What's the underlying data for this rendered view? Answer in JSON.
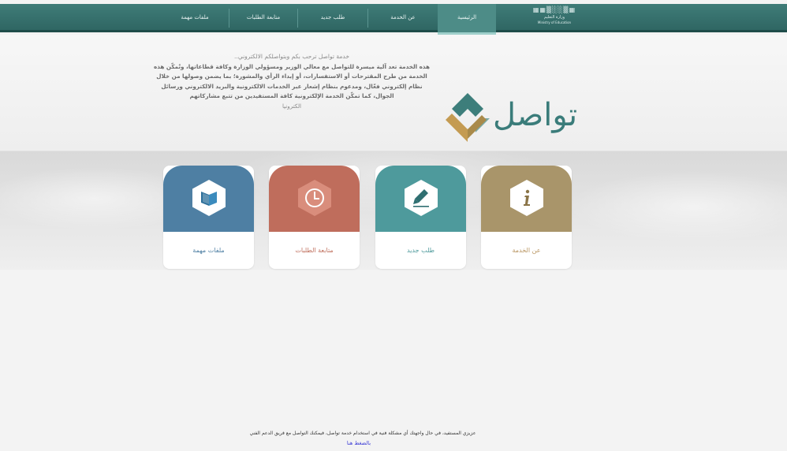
{
  "nav": {
    "logo_dots": "▦▦▒░░▒▦",
    "logo_line1": "وزارة التعليم",
    "logo_line2": "Ministry of Education",
    "items": [
      {
        "label": "الرئيسية",
        "active": true
      },
      {
        "label": "عن الخدمة",
        "active": false
      },
      {
        "label": "طلب جديد",
        "active": false
      },
      {
        "label": "متابعة الطلبات",
        "active": false
      },
      {
        "label": "ملفات مهمة",
        "active": false
      }
    ]
  },
  "hero": {
    "welcome": "خدمة تواصل ترحب بكم وبتواصلكم الالكتروني..",
    "body": "هذه الخدمة تعد آلية ميسرة للتواصل مع معالي الوزير ومسؤولي الوزارة وكافة قطاعاتها، وتُمكّن هذه الخدمة من طرح المقترحات أو الاستفسارات، أو إبداء الرأي والمشورة؛ بما يضمن وصولها من خلال نظام إلكتروني فعّال، ومدعوم بنظام إشعار عبر الخدمات الالكترونية والبريد الالكتروني ورسائل الجوال، كما تمكّن الخدمة الإلكترونية كافة المستفيدين من تتبع مشاركاتهم",
    "tail": "الكترونيا",
    "brand_name": "تواصل"
  },
  "colors": {
    "nav_bg": "#326b68",
    "card_about": "#a9956a",
    "card_new": "#4e9a9c",
    "card_track": "#bf6d5c",
    "card_files": "#4e7fa3",
    "label_about": "#b89460",
    "label_new": "#4e9a9c",
    "label_track": "#c0705e",
    "label_files": "#4e7fa3"
  },
  "cards": [
    {
      "label": "عن الخدمة",
      "icon": "info-icon"
    },
    {
      "label": "طلب جديد",
      "icon": "pencil-icon"
    },
    {
      "label": "متابعة الطلبات",
      "icon": "clock-icon"
    },
    {
      "label": "ملفات مهمة",
      "icon": "book-icon"
    }
  ],
  "footer": {
    "text": "عزيزي المستفيد، في حال واجهتك أي مشكلة فنية في استخدام خدمة تواصل، فيمكنك التواصل مع فريق الدعم الفني",
    "link": "بالضغط هنا"
  }
}
